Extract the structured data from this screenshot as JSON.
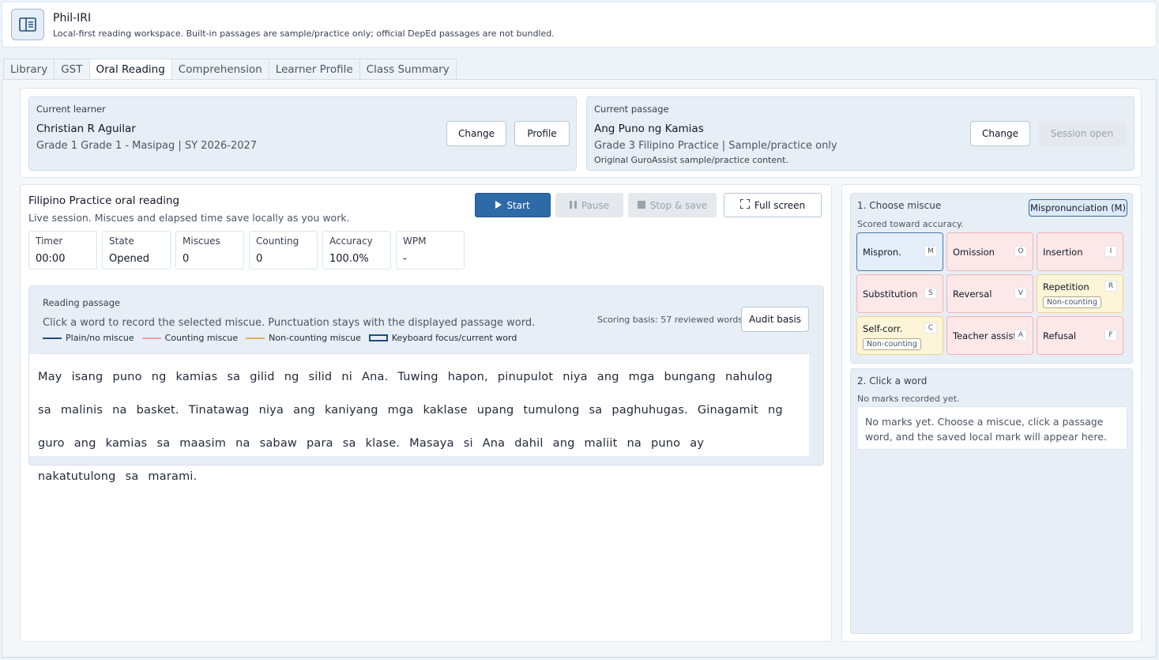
{
  "app": {
    "title": "Phil-IRI",
    "subtitle": "Local-first reading workspace. Built-in passages are sample/practice only; official DepEd passages are not bundled.",
    "logo_icon": "book-open-icon"
  },
  "tabs": [
    {
      "label": "Library"
    },
    {
      "label": "GST"
    },
    {
      "label": "Oral Reading",
      "active": true
    },
    {
      "label": "Comprehension"
    },
    {
      "label": "Learner Profile"
    },
    {
      "label": "Class Summary"
    }
  ],
  "learner": {
    "label": "Current learner",
    "name": "Christian R Aguilar",
    "meta": "Grade 1 Grade 1 - Masipag | SY 2026-2027",
    "change_label": "Change",
    "profile_label": "Profile"
  },
  "passage_card": {
    "label": "Current passage",
    "name": "Ang Puno ng Kamias",
    "meta": "Grade 3 Filipino Practice | Sample/practice only",
    "note": "Original GuroAssist sample/practice content.",
    "change_label": "Change",
    "session_label": "Session open"
  },
  "reading": {
    "title": "Filipino Practice oral reading",
    "subtitle": "Live session. Miscues and elapsed time save locally as you work.",
    "controls": {
      "start": "Start",
      "pause": "Pause",
      "stop": "Stop & save",
      "fullscreen": "Full screen"
    },
    "stats": [
      {
        "label": "Timer",
        "value": "00:00"
      },
      {
        "label": "State",
        "value": "Opened"
      },
      {
        "label": "Miscues",
        "value": "0"
      },
      {
        "label": "Counting",
        "value": "0"
      },
      {
        "label": "Accuracy",
        "value": "100.0%"
      },
      {
        "label": "WPM",
        "value": "-"
      }
    ]
  },
  "passage": {
    "title": "Reading passage",
    "instructions": "Click a word to record the selected miscue. Punctuation stays with the displayed passage word.",
    "legend": [
      {
        "label": "Plain/no miscue",
        "color": "#1f4e7e",
        "kind": "line"
      },
      {
        "label": "Counting miscue",
        "color": "#f0a0a0",
        "kind": "line"
      },
      {
        "label": "Non-counting miscue",
        "color": "#e0b25a",
        "kind": "line"
      },
      {
        "label": "Keyboard focus/current word",
        "color": "#1f4e7e",
        "kind": "box"
      }
    ],
    "basis": "Scoring basis: 57 reviewed words.",
    "audit_label": "Audit basis",
    "words": [
      "May",
      "isang",
      "puno",
      "ng",
      "kamias",
      "sa",
      "gilid",
      "ng",
      "silid",
      "ni",
      "Ana.",
      "Tuwing",
      "hapon,",
      "pinupulot",
      "niya",
      "ang",
      "mga",
      "bungang",
      "nahulog",
      "sa",
      "malinis",
      "na",
      "basket.",
      "Tinatawag",
      "niya",
      "ang",
      "kaniyang",
      "mga",
      "kaklase",
      "upang",
      "tumulong",
      "sa",
      "paghuhugas.",
      "Ginagamit",
      "ng",
      "guro",
      "ang",
      "kamias",
      "sa",
      "maasim",
      "na",
      "sabaw",
      "para",
      "sa",
      "klase.",
      "Masaya",
      "si",
      "Ana",
      "dahil",
      "ang",
      "maliit",
      "na",
      "puno",
      "ay",
      "nakatutulong",
      "sa",
      "marami."
    ]
  },
  "miscue": {
    "title": "1. Choose miscue",
    "subtitle": "Scored toward accuracy.",
    "selected": "Mispronunciation (M)",
    "options": [
      {
        "label": "Mispron.",
        "key": "M",
        "tone": "blue"
      },
      {
        "label": "Omission",
        "key": "O",
        "tone": "red"
      },
      {
        "label": "Insertion",
        "key": "I",
        "tone": "red"
      },
      {
        "label": "Substitution",
        "key": "S",
        "tone": "red"
      },
      {
        "label": "Reversal",
        "key": "V",
        "tone": "red"
      },
      {
        "label": "Repetition",
        "key": "R",
        "tone": "yel",
        "tag": "Non-counting"
      },
      {
        "label": "Self-corr.",
        "key": "C",
        "tone": "yel",
        "tag": "Non-counting"
      },
      {
        "label": "Teacher assist",
        "key": "A",
        "tone": "red"
      },
      {
        "label": "Refusal",
        "key": "F",
        "tone": "red"
      }
    ]
  },
  "word_panel": {
    "title": "2. Click a word",
    "subtitle": "No marks recorded yet.",
    "empty": "No marks yet. Choose a miscue, click a passage word, and the saved local mark will appear here."
  }
}
